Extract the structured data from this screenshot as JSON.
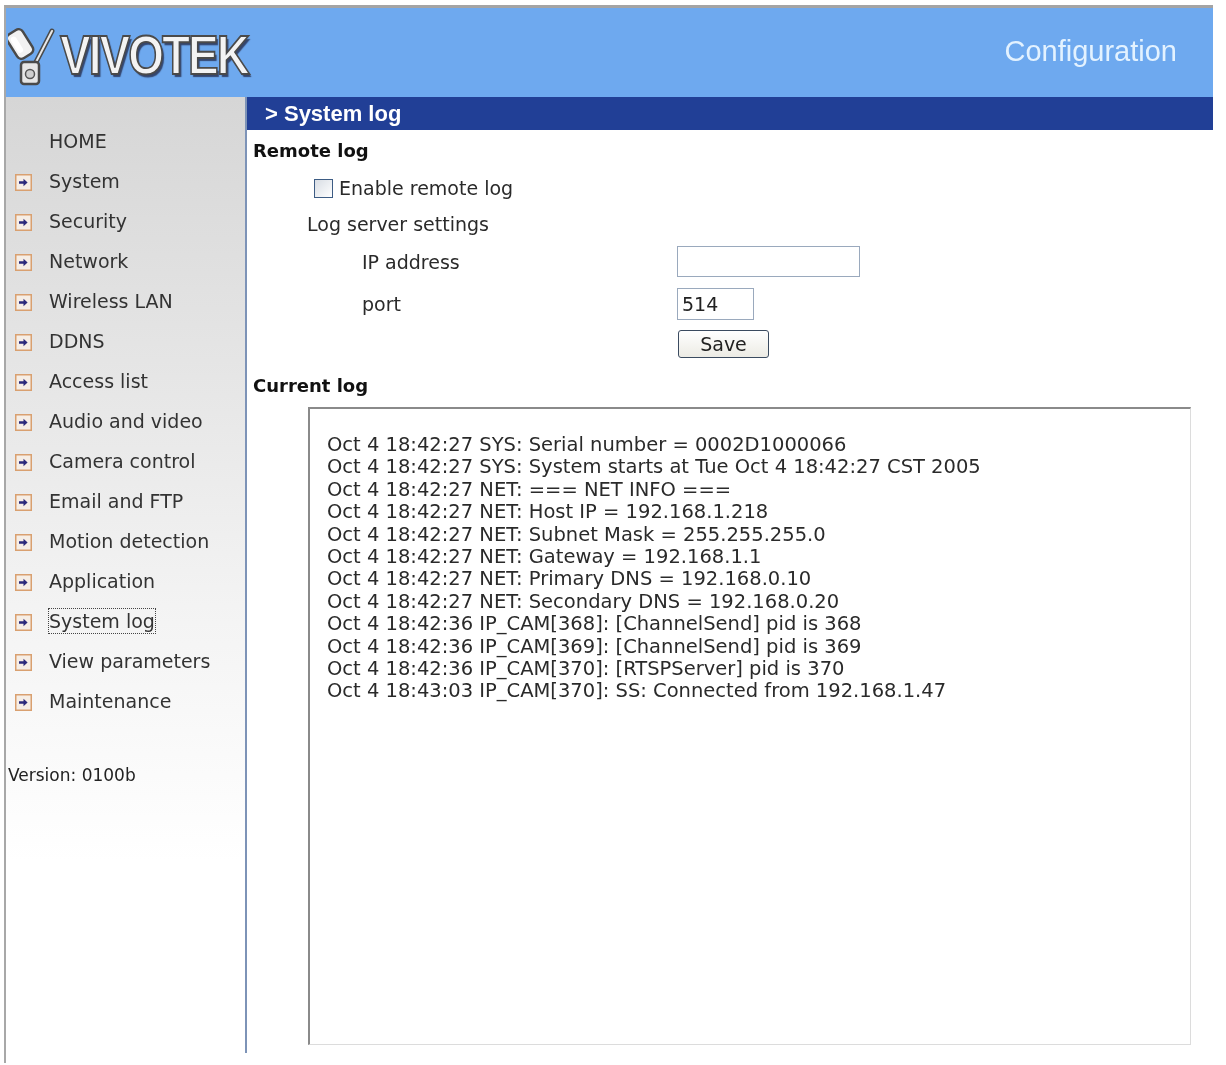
{
  "header": {
    "logo": "VIVOTEK",
    "title": "Configuration"
  },
  "sidebar": {
    "home": "HOME",
    "items": [
      {
        "label": "System",
        "selected": false
      },
      {
        "label": "Security",
        "selected": false
      },
      {
        "label": "Network",
        "selected": false
      },
      {
        "label": "Wireless LAN",
        "selected": false
      },
      {
        "label": "DDNS",
        "selected": false
      },
      {
        "label": "Access list",
        "selected": false
      },
      {
        "label": "Audio and video",
        "selected": false
      },
      {
        "label": "Camera control",
        "selected": false
      },
      {
        "label": "Email and FTP",
        "selected": false
      },
      {
        "label": "Motion detection",
        "selected": false
      },
      {
        "label": "Application",
        "selected": false
      },
      {
        "label": "System log",
        "selected": true
      },
      {
        "label": "View parameters",
        "selected": false
      },
      {
        "label": "Maintenance",
        "selected": false
      }
    ],
    "version": "Version: 0100b"
  },
  "page_title": "> System log",
  "remote_log": {
    "heading": "Remote log",
    "enable": {
      "label": "Enable remote log",
      "checked": false
    },
    "settings_label": "Log server settings",
    "fields": [
      {
        "kind": "ip",
        "label": "IP address"
      },
      {
        "kind": "port",
        "label": "port",
        "value": "514"
      }
    ],
    "save_button": "Save"
  },
  "current_log": {
    "heading": "Current log",
    "lines": [
      "Oct 4 18:42:27 SYS: Serial number = 0002D1000066",
      "Oct 4 18:42:27 SYS: System starts at Tue Oct 4 18:42:27 CST 2005",
      "Oct 4 18:42:27 NET: === NET INFO ===",
      "Oct 4 18:42:27 NET: Host IP = 192.168.1.218",
      "Oct 4 18:42:27 NET: Subnet Mask = 255.255.255.0",
      "Oct 4 18:42:27 NET: Gateway = 192.168.1.1",
      "Oct 4 18:42:27 NET: Primary DNS = 192.168.0.10",
      "Oct 4 18:42:27 NET: Secondary DNS = 192.168.0.20",
      "Oct 4 18:42:36 IP_CAM[368]: [ChannelSend] pid is 368",
      "Oct 4 18:42:36 IP_CAM[369]: [ChannelSend] pid is 369",
      "Oct 4 18:42:36 IP_CAM[370]: [RTSPServer] pid is 370",
      "Oct 4 18:43:03 IP_CAM[370]: SS: Connected from 192.168.1.47"
    ]
  }
}
